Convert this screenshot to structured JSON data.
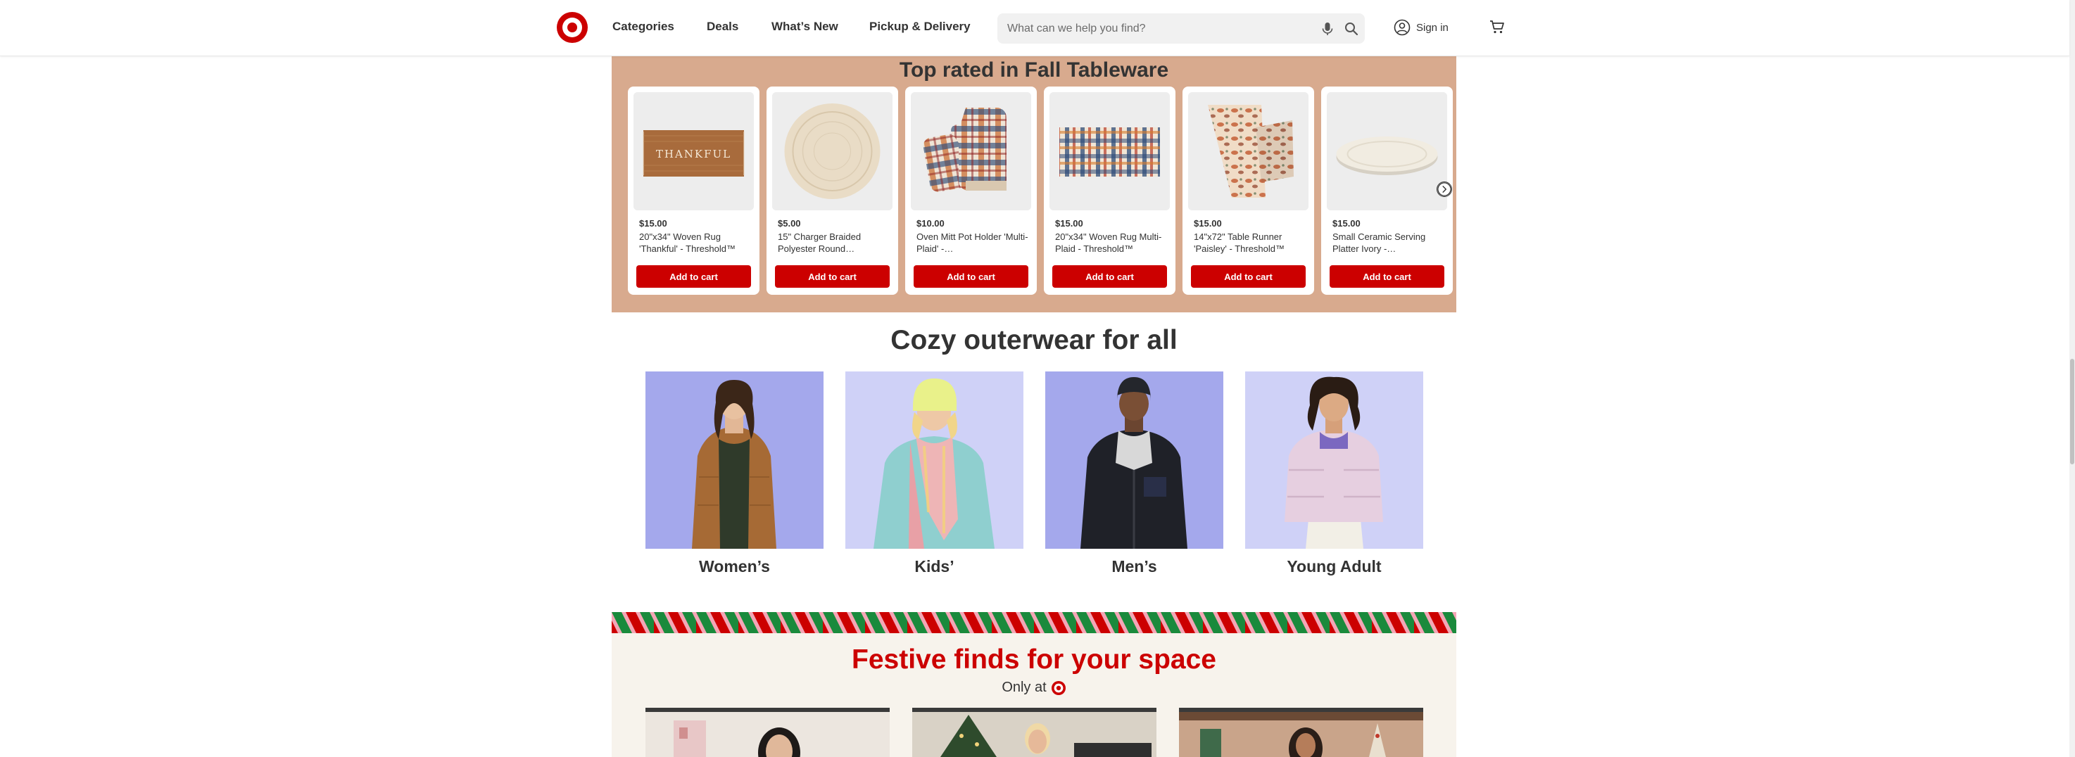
{
  "header": {
    "nav": [
      "Categories",
      "Deals",
      "What’s New",
      "Pickup & Delivery"
    ],
    "search_placeholder": "What can we help you find?",
    "signin_label": "Sign in"
  },
  "tableware": {
    "title": "Top rated in Fall Tableware",
    "products": [
      {
        "price": "$15.00",
        "title": "20\"x34\" Woven Rug 'Thankful' - Threshold™",
        "cta": "Add to cart",
        "image_text": "THANKFUL"
      },
      {
        "price": "$5.00",
        "title": "15\" Charger Braided Polyester Round…",
        "cta": "Add to cart"
      },
      {
        "price": "$10.00",
        "title": "Oven Mitt Pot Holder 'Multi-Plaid' -…",
        "cta": "Add to cart"
      },
      {
        "price": "$15.00",
        "title": "20\"x34\" Woven Rug Multi-Plaid - Threshold™",
        "cta": "Add to cart"
      },
      {
        "price": "$15.00",
        "title": "14\"x72\" Table Runner 'Paisley' - Threshold™",
        "cta": "Add to cart"
      },
      {
        "price": "$15.00",
        "title": "Small Ceramic Serving Platter Ivory -…",
        "cta": "Add to cart"
      }
    ]
  },
  "outerwear": {
    "title": "Cozy outerwear for all",
    "categories": [
      "Women’s",
      "Kids’",
      "Men’s",
      "Young Adult"
    ]
  },
  "festive": {
    "title": "Festive finds for your space",
    "subtitle": "Only at"
  },
  "colors": {
    "brand_red": "#cc0000",
    "tableware_bg": "#d8aa8e",
    "festive_bg": "#f7f3ec",
    "stripe_green": "#1a8a3c",
    "stripe_pink": "#f4a6b6"
  },
  "icons": [
    "target-logo",
    "mic-icon",
    "search-icon",
    "account-icon",
    "cart-icon",
    "chevron-right-icon"
  ]
}
